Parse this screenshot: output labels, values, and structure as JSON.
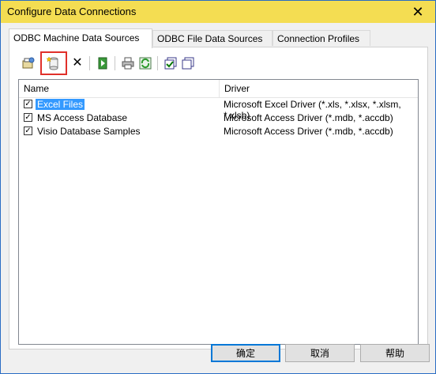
{
  "window": {
    "title": "Configure Data Connections"
  },
  "tabs": [
    {
      "label": "ODBC Machine Data Sources",
      "active": true
    },
    {
      "label": "ODBC File Data Sources",
      "active": false
    },
    {
      "label": "Connection Profiles",
      "active": false
    }
  ],
  "toolbar": {
    "buttons": [
      {
        "icon": "configure-icon"
      },
      {
        "icon": "new-datasource-icon",
        "highlighted": true
      },
      {
        "icon": "delete-icon"
      },
      {
        "icon": "test-connection-icon"
      },
      {
        "icon": "print-icon"
      },
      {
        "icon": "refresh-icon"
      },
      {
        "icon": "check-all-icon"
      },
      {
        "icon": "uncheck-all-icon"
      }
    ]
  },
  "list": {
    "columns": [
      "Name",
      "Driver"
    ],
    "rows": [
      {
        "checked": true,
        "name": "Excel Files",
        "driver": "Microsoft Excel Driver (*.xls, *.xlsx, *.xlsm, *.xlsb)",
        "selected": true
      },
      {
        "checked": true,
        "name": "MS Access Database",
        "driver": "Microsoft Access Driver (*.mdb, *.accdb)",
        "selected": false
      },
      {
        "checked": true,
        "name": "Visio Database Samples",
        "driver": "Microsoft Access Driver (*.mdb, *.accdb)",
        "selected": false
      }
    ]
  },
  "buttons": {
    "ok": "确定",
    "cancel": "取消",
    "help": "帮助"
  },
  "colors": {
    "titlebar": "#f4dd52",
    "selection": "#3399ff",
    "highlight_border": "#e0302a",
    "default_button_border": "#0078d7"
  }
}
